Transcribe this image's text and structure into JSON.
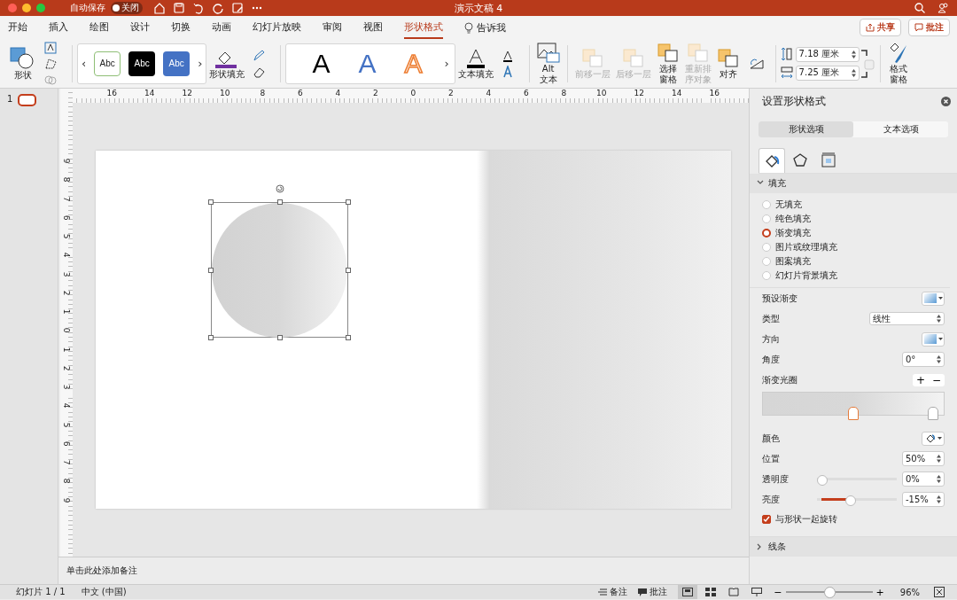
{
  "title_bar": {
    "autosave_label": "自动保存",
    "autosave": {
      "on": false,
      "label": "关闭"
    },
    "title": "演示文稿 4"
  },
  "tabs": [
    {
      "label": "开始",
      "selected": false
    },
    {
      "label": "插入",
      "selected": false
    },
    {
      "label": "绘图",
      "selected": false
    },
    {
      "label": "设计",
      "selected": false
    },
    {
      "label": "切换",
      "selected": false
    },
    {
      "label": "动画",
      "selected": false
    },
    {
      "label": "幻灯片放映",
      "selected": false
    },
    {
      "label": "审阅",
      "selected": false
    },
    {
      "label": "视图",
      "selected": false
    },
    {
      "label": "形状格式",
      "selected": true
    }
  ],
  "tell_me": "告诉我",
  "share_button": "共享",
  "comments_button": "批注",
  "ribbon": {
    "shapes_label": "形状",
    "style_gallery": [
      {
        "label": "Abc",
        "kind": "outline"
      },
      {
        "label": "Abc",
        "kind": "dark"
      },
      {
        "label": "Abc",
        "kind": "blue"
      }
    ],
    "gallery_prev": "‹",
    "gallery_next": "›",
    "shape_fill_label": "形状填充",
    "wordart_gallery": [
      {
        "label": "A",
        "kind": "black"
      },
      {
        "label": "A",
        "kind": "blue"
      },
      {
        "label": "A",
        "kind": "orange"
      }
    ],
    "text_fill_label": "文本填充",
    "alt_text_label": "Alt\n文本",
    "arrange": [
      {
        "label": "前移一层",
        "disabled": true,
        "kind": "one_line"
      },
      {
        "label": "后移一层",
        "disabled": true,
        "kind": "one_line"
      },
      {
        "label": "选择窗格",
        "disabled": false,
        "kind": "two_line"
      },
      {
        "label": "重新排序对象",
        "disabled": true,
        "kind": "two_line"
      },
      {
        "label": "对齐",
        "disabled": false,
        "kind": "one_line"
      }
    ],
    "height_value": "7.18 厘米",
    "width_value": "7.25 厘米",
    "format_pane_label": "格式窗格"
  },
  "slides_pane": {
    "slides": [
      {
        "number": "1",
        "selected": true
      }
    ]
  },
  "ruler": {
    "horizontal": [
      "16",
      "14",
      "12",
      "10",
      "8",
      "6",
      "4",
      "2",
      "0",
      "2",
      "4",
      "6",
      "8",
      "10",
      "12",
      "14",
      "16"
    ],
    "vertical": [
      "9",
      "8",
      "7",
      "6",
      "5",
      "4",
      "3",
      "2",
      "1",
      "0",
      "1",
      "2",
      "3",
      "4",
      "5",
      "6",
      "7",
      "8",
      "9"
    ]
  },
  "notes_placeholder": "单击此处添加备注",
  "format_panel": {
    "title": "设置形状格式",
    "option_tabs": [
      {
        "label": "形状选项",
        "selected": true
      },
      {
        "label": "文本选项",
        "selected": false
      }
    ],
    "icon_tabs": [
      {
        "kind": "fill",
        "selected": true
      },
      {
        "kind": "effects",
        "selected": false
      },
      {
        "kind": "size",
        "selected": false
      }
    ],
    "fill_section": {
      "label": "填充",
      "expanded": true,
      "options": [
        {
          "label": "无填充",
          "selected": false
        },
        {
          "label": "纯色填充",
          "selected": false
        },
        {
          "label": "渐变填充",
          "selected": true
        },
        {
          "label": "图片或纹理填充",
          "selected": false
        },
        {
          "label": "图案填充",
          "selected": false
        },
        {
          "label": "幻灯片背景填充",
          "selected": false
        }
      ],
      "preset_label": "预设渐变",
      "type_label": "类型",
      "type_value": "线性",
      "direction_label": "方向",
      "angle_label": "角度",
      "angle_value": "0°",
      "stops_label": "渐变光圈",
      "add_stop": "+",
      "remove_stop": "−",
      "stops": [
        {
          "level": 0.5,
          "selected": true
        },
        {
          "level": 0.94,
          "selected": false
        }
      ],
      "color_label": "颜色",
      "position_label": "位置",
      "position_value": "50%",
      "transparency_label": "透明度",
      "transparency": {
        "level": 0,
        "value": "0%"
      },
      "brightness_label": "亮度",
      "brightness": {
        "level": 0.4,
        "value": "-15%"
      },
      "rotate_with_shape": {
        "label": "与形状一起旋转",
        "checked": true
      }
    },
    "line_section": {
      "label": "线条",
      "expanded": false
    }
  },
  "status_bar": {
    "slide_info": "幻灯片 1 / 1",
    "language": "中文 (中国)",
    "notes": "备注",
    "comments": "批注",
    "views": [
      {
        "kind": "normal",
        "selected": true
      },
      {
        "kind": "sorter",
        "selected": false
      },
      {
        "kind": "reading",
        "selected": false
      },
      {
        "kind": "show",
        "selected": false
      }
    ],
    "zoom_out": "−",
    "zoom_in": "+",
    "zoom": {
      "level": 0.5
    },
    "zoom_value": "96%"
  }
}
